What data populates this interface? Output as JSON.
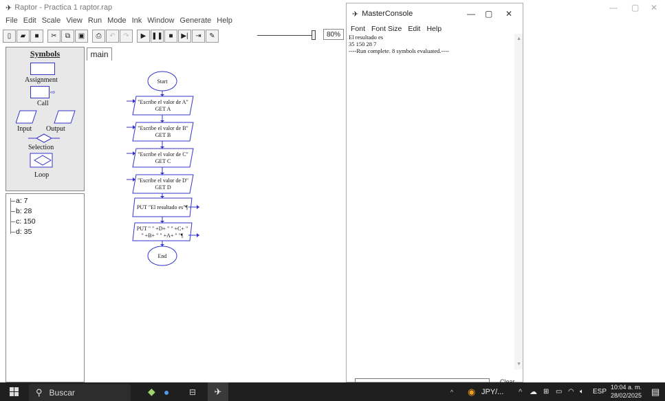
{
  "app": {
    "title": "Raptor - Practica 1 raptor.rap",
    "menu": [
      "File",
      "Edit",
      "Scale",
      "View",
      "Run",
      "Mode",
      "Ink",
      "Window",
      "Generate",
      "Help"
    ],
    "zoom_level": "80%",
    "zoom_fraction": 0.8
  },
  "symbols_panel": {
    "heading": "Symbols",
    "items": [
      "Assignment",
      "Call",
      "Input",
      "Output",
      "Selection",
      "Loop"
    ]
  },
  "variables": [
    "a: 7",
    "b: 28",
    "c: 150",
    "d: 35"
  ],
  "tabs": [
    "main"
  ],
  "flowchart": {
    "start": "Start",
    "end": "End",
    "inputs": [
      {
        "prompt": "\"Escribe el valor de A\"",
        "get": "GET A"
      },
      {
        "prompt": "\"Escribe el valor de B\"",
        "get": "GET B"
      },
      {
        "prompt": "\"Escribe el valor de C\"",
        "get": "GET C"
      },
      {
        "prompt": "\"Escribe el valor de D\"",
        "get": "GET D"
      }
    ],
    "output1": "PUT \"El resultado es\"¶",
    "output2_line1": "PUT \" \" +D+ \" \" +C+ \"",
    "output2_line2": "\" +B+ \" \" +A+ \" \"¶"
  },
  "console": {
    "title": "MasterConsole",
    "menu": [
      "Font",
      "Font Size",
      "Edit",
      "Help"
    ],
    "lines": [
      "El resultado es",
      "35 150 28 7",
      "----Run complete.  8 symbols evaluated.----"
    ],
    "clear_label": "Clear"
  },
  "taskbar": {
    "search_placeholder": "Buscar",
    "currency": "JPY/...",
    "language": "ESP",
    "time": "10:04 a. m.",
    "date": "28/02/2025"
  }
}
